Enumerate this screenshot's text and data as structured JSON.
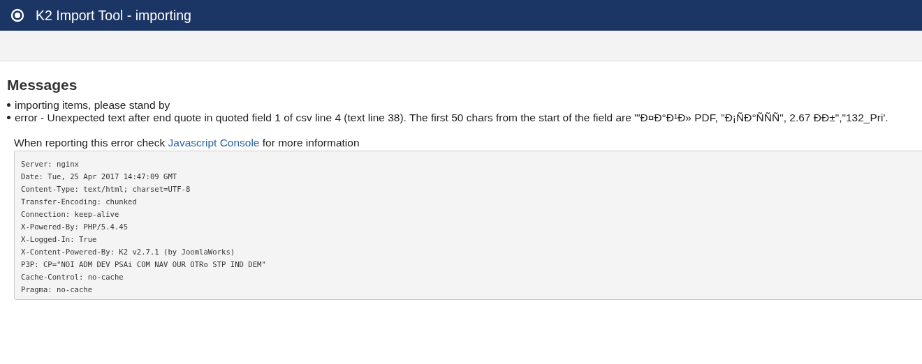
{
  "header": {
    "title": "K2 Import Tool - importing"
  },
  "messages": {
    "heading": "Messages",
    "items": [
      "importing items, please stand by",
      "error - Unexpected text after end quote in quoted field 1 of csv line 4 (text line 38). The first 50 chars from the start of the field are '\"Đ¤Đ°Đ¹Đ» PDF, \"Đ¡ÑĐ°ÑÑÑ\", 2.67 ĐĐ±\",\"132_Pri'."
    ],
    "report": {
      "before": "When reporting this error check",
      "link": "Javascript Console",
      "after": "for more information"
    },
    "headers": [
      "Server: nginx",
      "Date: Tue, 25 Apr 2017 14:47:09 GMT",
      "Content-Type: text/html; charset=UTF-8",
      "Transfer-Encoding: chunked",
      "Connection: keep-alive",
      "X-Powered-By: PHP/5.4.45",
      "X-Logged-In: True",
      "X-Content-Powered-By: K2 v2.7.1 (by JoomlaWorks)",
      "P3P: CP=\"NOI ADM DEV PSAi COM NAV OUR OTRo STP IND DEM\"",
      "Cache-Control: no-cache",
      "Pragma: no-cache"
    ]
  }
}
